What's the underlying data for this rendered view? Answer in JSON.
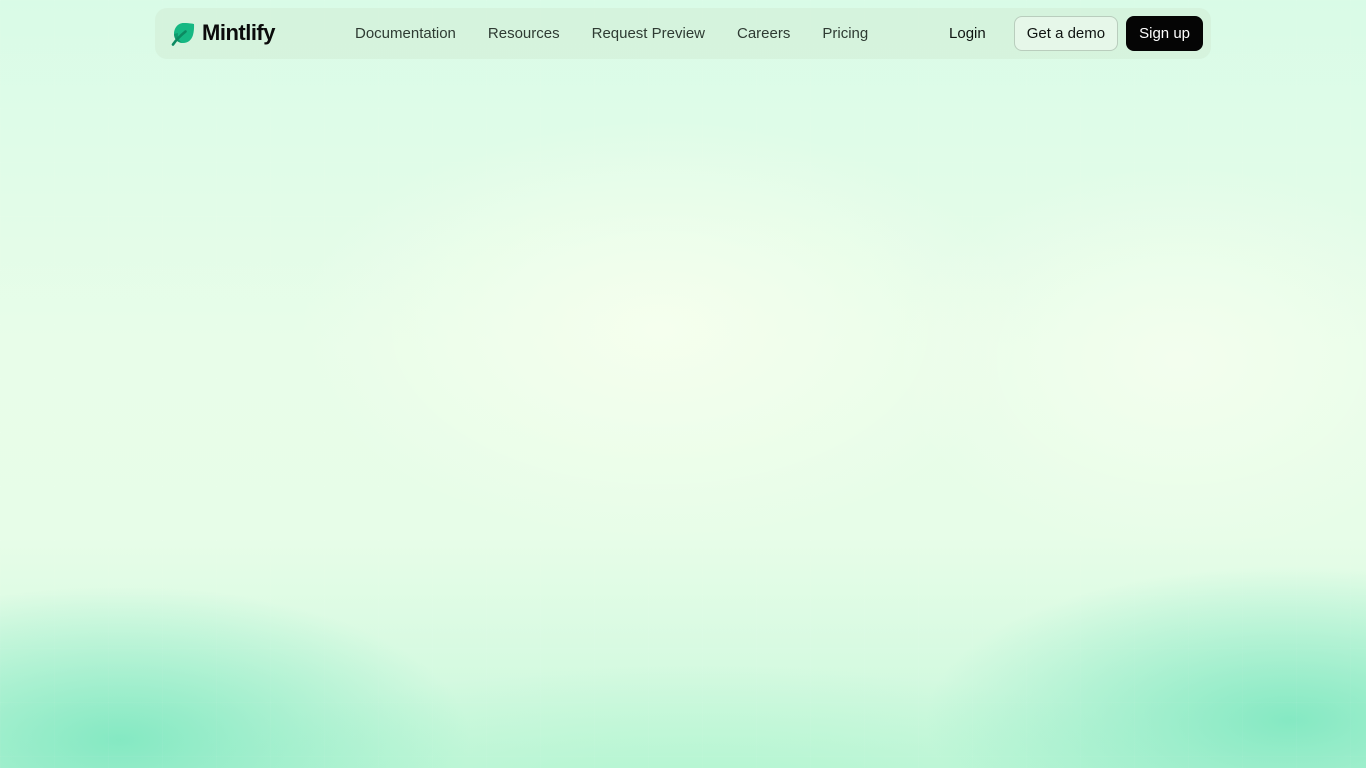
{
  "brand": {
    "name": "Mintlify",
    "logo_icon": "mintlify-leaf-icon",
    "colors": {
      "primary_green": "#16b883",
      "dark_green": "#0c8a61",
      "text": "#0b0b0b"
    }
  },
  "nav": {
    "links": [
      {
        "label": "Documentation"
      },
      {
        "label": "Resources"
      },
      {
        "label": "Request Preview"
      },
      {
        "label": "Careers"
      },
      {
        "label": "Pricing"
      }
    ],
    "login_label": "Login",
    "demo_label": "Get a demo",
    "signup_label": "Sign up"
  },
  "theme": {
    "background": "#ddfbe6",
    "accent_bottom": "#78e6be",
    "signup_bg": "#050505"
  }
}
